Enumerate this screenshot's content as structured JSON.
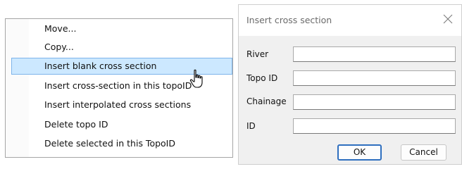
{
  "context_menu": {
    "items": [
      {
        "label": "Move..."
      },
      {
        "label": "Copy..."
      },
      {
        "label": "Insert blank cross section",
        "highlighted": true
      },
      {
        "label": "Insert cross-section in this topoID"
      },
      {
        "label": "Insert interpolated cross sections"
      },
      {
        "label": "Delete topo ID"
      },
      {
        "label": "Delete selected in this TopoID"
      }
    ]
  },
  "dialog": {
    "title": "Insert cross section",
    "close_icon": "close-icon",
    "fields": [
      {
        "label": "River",
        "value": ""
      },
      {
        "label": "Topo ID",
        "value": ""
      },
      {
        "label": "Chainage",
        "value": ""
      },
      {
        "label": "ID",
        "value": ""
      }
    ],
    "ok_label": "OK",
    "cancel_label": "Cancel"
  },
  "colors": {
    "highlight_fill": "#cce8ff",
    "highlight_border": "#7eb4ea",
    "default_button_border": "#2f6fbf"
  }
}
